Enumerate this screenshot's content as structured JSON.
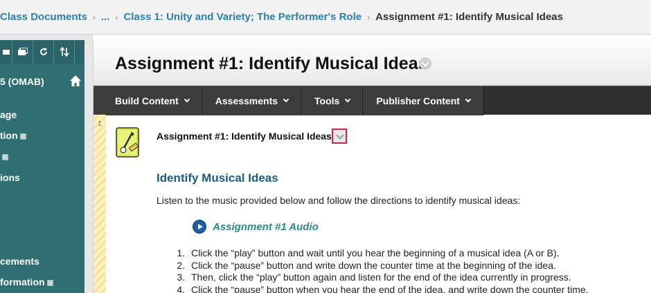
{
  "breadcrumb": {
    "items": [
      {
        "label": "Class Documents"
      },
      {
        "label": "..."
      },
      {
        "label": "Class 1: Unity and Variety; The Performer's Role"
      }
    ],
    "current": "Assignment #1: Identify Musical Ideas"
  },
  "sidebar": {
    "tools": [
      "folder-icon",
      "display-icon",
      "refresh-icon",
      "sort-icon"
    ],
    "course_title": "5 (OMAB)",
    "items": [
      {
        "label": "age",
        "external": false
      },
      {
        "label": "tion",
        "external": true
      },
      {
        "label": "",
        "external": true
      },
      {
        "label": "ions",
        "external": false
      },
      {
        "label": "cements",
        "external": false
      },
      {
        "label": "formation",
        "external": true
      }
    ]
  },
  "page": {
    "title": "Assignment #1: Identify Musical Ideas"
  },
  "actionbar": {
    "items": [
      "Build Content",
      "Assessments",
      "Tools",
      "Publisher Content"
    ]
  },
  "item": {
    "title": "Assignment #1: Identify Musical Ideas",
    "heading": "Identify Musical Ideas",
    "intro": "Listen to the music provided below and follow the directions to identify musical ideas:",
    "audio_label": "Assignment #1 Audio",
    "steps": [
      {
        "num": "1.",
        "text": "Click the “play” button and wait until you hear the beginning of a musical idea (A or B)."
      },
      {
        "num": "2.",
        "text": "Click the “pause” button and write down the counter time at the beginning of the idea."
      },
      {
        "num": "3.",
        "text": "Then, click the “play” button again and listen for the end of the idea currently in progress."
      },
      {
        "num": "4.",
        "text": "Click the “pause” button when you hear the end of the idea, and write down the counter time."
      }
    ]
  },
  "colors": {
    "sidebar": "#2f6f72",
    "link": "#2a7fb0",
    "heading": "#1d5a80",
    "audio_link": "#2a8a86",
    "actionbar": "#3c3c3c"
  }
}
